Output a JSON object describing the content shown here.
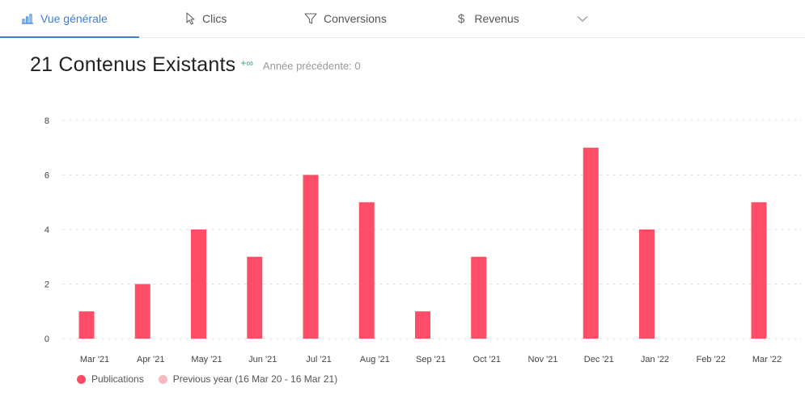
{
  "tabs": [
    {
      "label": "Vue générale",
      "icon": "bar-chart-icon",
      "active": true
    },
    {
      "label": "Clics",
      "icon": "cursor-icon",
      "active": false
    },
    {
      "label": "Conversions",
      "icon": "funnel-icon",
      "active": false
    },
    {
      "label": "Revenus",
      "icon": "dollar-icon",
      "active": false
    }
  ],
  "headline": {
    "count": "21 Contenus Existants",
    "delta": "+∞",
    "previous": "Année précédente: 0"
  },
  "colors": {
    "accent": "#3d7ed6",
    "bar": "#ff4d67",
    "previous": "#f6b9c2",
    "delta": "#32a873"
  },
  "chart_data": {
    "type": "bar",
    "categories": [
      "Mar '21",
      "Apr '21",
      "May '21",
      "Jun '21",
      "Jul '21",
      "Aug '21",
      "Sep '21",
      "Oct '21",
      "Nov '21",
      "Dec '21",
      "Jan '22",
      "Feb '22",
      "Mar '22"
    ],
    "series": [
      {
        "name": "Publications",
        "values": [
          1,
          2,
          4,
          3,
          6,
          5,
          1,
          3,
          0,
          7,
          4,
          0,
          5
        ]
      },
      {
        "name": "Previous year (16 Mar 20 - 16 Mar 21)",
        "values": [
          0,
          0,
          0,
          0,
          0,
          0,
          0,
          0,
          0,
          0,
          0,
          0,
          0
        ]
      }
    ],
    "yticks": [
      0,
      2,
      4,
      6,
      8
    ],
    "ylim": [
      0,
      8
    ],
    "grid": true,
    "legend": "bottom-left"
  }
}
